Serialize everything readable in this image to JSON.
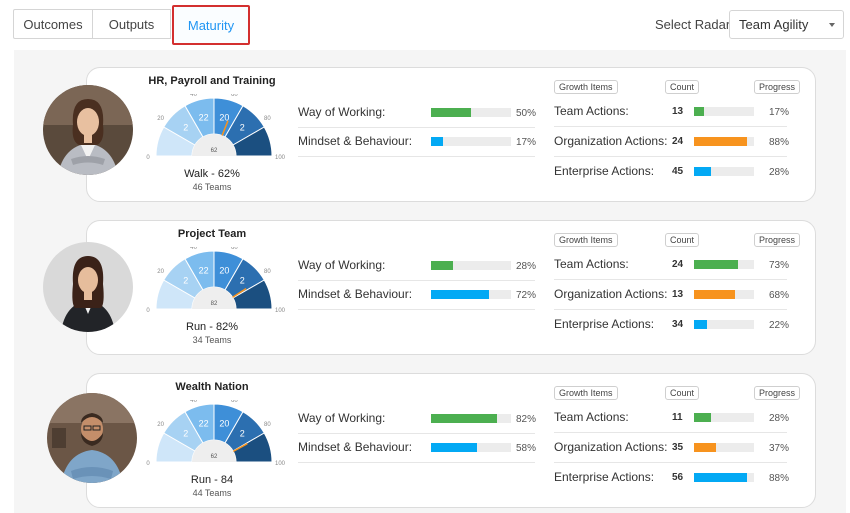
{
  "tabs": [
    "Outcomes",
    "Outputs",
    "Maturity"
  ],
  "radar": {
    "label": "Select Radar",
    "value": "Team Agility"
  },
  "headers": {
    "growth": "Growth Items",
    "count": "Count",
    "progress": "Progress"
  },
  "colors": {
    "green": "#4caf50",
    "blue": "#03a9f4",
    "orange": "#f7931e"
  },
  "gauge_scale": {
    "ticks": [
      "0",
      "20",
      "40",
      "60",
      "80",
      "100"
    ],
    "segments": [
      "2",
      "22",
      "20",
      "2"
    ]
  },
  "cards": [
    {
      "title": "HR, Payroll and Training",
      "gauge_value": "62",
      "gauge_percent": 62,
      "level": "Walk - 62%",
      "teams": "46 Teams",
      "metrics": [
        {
          "label": "Way of Working:",
          "value": 50,
          "pct": "50%",
          "color": "green"
        },
        {
          "label": "Mindset & Behaviour:",
          "value": 17,
          "pct": "17%",
          "color": "blue"
        }
      ],
      "actions": [
        {
          "label": "Team Actions:",
          "count": "13",
          "value": 17,
          "pct": "17%",
          "color": "green"
        },
        {
          "label": "Organization Actions:",
          "count": "24",
          "value": 88,
          "pct": "88%",
          "color": "orange"
        },
        {
          "label": "Enterprise Actions:",
          "count": "45",
          "value": 28,
          "pct": "28%",
          "color": "blue"
        }
      ]
    },
    {
      "title": "Project Team",
      "gauge_value": "82",
      "gauge_percent": 82,
      "level": "Run - 82%",
      "teams": "34 Teams",
      "metrics": [
        {
          "label": "Way of Working:",
          "value": 28,
          "pct": "28%",
          "color": "green"
        },
        {
          "label": "Mindset & Behaviour:",
          "value": 72,
          "pct": "72%",
          "color": "blue"
        }
      ],
      "actions": [
        {
          "label": "Team Actions:",
          "count": "24",
          "value": 73,
          "pct": "73%",
          "color": "green"
        },
        {
          "label": "Organization Actions:",
          "count": "13",
          "value": 68,
          "pct": "68%",
          "color": "orange"
        },
        {
          "label": "Enterprise Actions:",
          "count": "34",
          "value": 22,
          "pct": "22%",
          "color": "blue"
        }
      ]
    },
    {
      "title": "Wealth Nation",
      "gauge_value": "62",
      "gauge_percent": 84,
      "level": "Run - 84",
      "teams": "44 Teams",
      "metrics": [
        {
          "label": "Way of Working:",
          "value": 82,
          "pct": "82%",
          "color": "green"
        },
        {
          "label": "Mindset & Behaviour:",
          "value": 58,
          "pct": "58%",
          "color": "blue"
        }
      ],
      "actions": [
        {
          "label": "Team Actions:",
          "count": "11",
          "value": 28,
          "pct": "28%",
          "color": "green"
        },
        {
          "label": "Organization Actions:",
          "count": "35",
          "value": 37,
          "pct": "37%",
          "color": "orange"
        },
        {
          "label": "Enterprise Actions:",
          "count": "56",
          "value": 88,
          "pct": "88%",
          "color": "blue"
        }
      ]
    }
  ]
}
